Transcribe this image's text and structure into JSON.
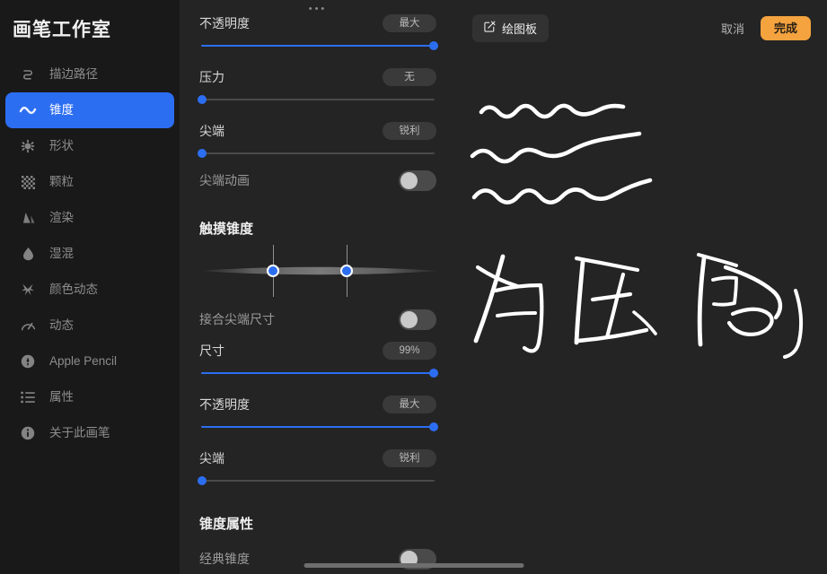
{
  "sidebar": {
    "title": "画笔工作室",
    "items": [
      {
        "label": "描边路径",
        "icon": "stroke-path-icon",
        "selected": false
      },
      {
        "label": "锥度",
        "icon": "taper-wave-icon",
        "selected": true
      },
      {
        "label": "形状",
        "icon": "shape-icon",
        "selected": false
      },
      {
        "label": "颗粒",
        "icon": "grain-icon",
        "selected": false
      },
      {
        "label": "渲染",
        "icon": "render-icon",
        "selected": false
      },
      {
        "label": "湿混",
        "icon": "wet-mix-droplet-icon",
        "selected": false
      },
      {
        "label": "颜色动态",
        "icon": "color-dynamics-icon",
        "selected": false
      },
      {
        "label": "动态",
        "icon": "dynamics-gauge-icon",
        "selected": false
      },
      {
        "label": "Apple Pencil",
        "icon": "apple-pencil-icon",
        "selected": false
      },
      {
        "label": "属性",
        "icon": "properties-list-icon",
        "selected": false
      },
      {
        "label": "关于此画笔",
        "icon": "info-icon",
        "selected": false
      }
    ]
  },
  "settings": {
    "drag_dots": "•••",
    "pencil_group": [
      {
        "label": "不透明度",
        "value": "最大",
        "fill_pct": 100,
        "knob_pct": 100
      },
      {
        "label": "压力",
        "value": "无",
        "fill_pct": 0,
        "knob_pct": 0
      },
      {
        "label": "尖端",
        "value": "锐利",
        "fill_pct": 0,
        "knob_pct": 0
      }
    ],
    "tip_animation": {
      "label": "尖端动画",
      "on": false
    },
    "touch_section_title": "触摸锥度",
    "taper_widget": {
      "left_handle_pct": 31,
      "right_handle_pct": 62
    },
    "join_tip_size": {
      "label": "接合尖端尺寸",
      "on": false
    },
    "touch_group": [
      {
        "label": "尺寸",
        "value": "99%",
        "fill_pct": 99,
        "knob_pct": 99
      },
      {
        "label": "不透明度",
        "value": "最大",
        "fill_pct": 100,
        "knob_pct": 100
      },
      {
        "label": "尖端",
        "value": "锐利",
        "fill_pct": 0,
        "knob_pct": 0
      }
    ],
    "taper_properties_title": "锥度属性",
    "classic_taper": {
      "label": "经典锥度",
      "on": false
    }
  },
  "preview": {
    "board_chip": {
      "label": "绘图板",
      "icon": "edit-square-icon"
    },
    "cancel_label": "取消",
    "done_label": "完成",
    "handwriting_text": "有压感",
    "stroke_count": 3
  },
  "colors": {
    "accent_blue": "#2c6ef2",
    "done_orange": "#f4a33f",
    "sidebar_bg": "#191919",
    "panel_bg": "#242424",
    "stroke_white": "#ffffff"
  }
}
